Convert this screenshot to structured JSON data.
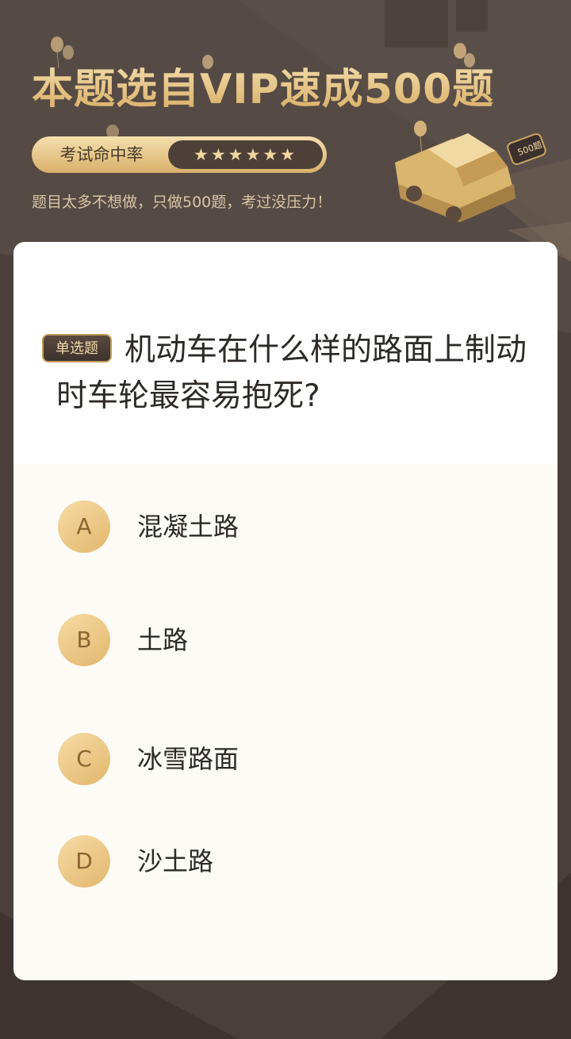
{
  "banner": {
    "title": "本题选自VIP速成500题",
    "rate_label": "考试命中率",
    "rate_stars": "★★★★★★",
    "subtitle": "题目太多不想做，只做500题，考过没压力！",
    "badge_text": "500题"
  },
  "question": {
    "type": "单选题",
    "text": "机动车在什么样的路面上制动时车轮最容易抱死?"
  },
  "options": [
    {
      "letter": "A",
      "text": "混凝土路"
    },
    {
      "letter": "B",
      "text": "土路"
    },
    {
      "letter": "C",
      "text": "冰雪路面"
    },
    {
      "letter": "D",
      "text": "沙土路"
    }
  ],
  "colors": {
    "background": "#4a3f3a",
    "gold": "#e2b76d",
    "card": "#fdfbf6"
  }
}
